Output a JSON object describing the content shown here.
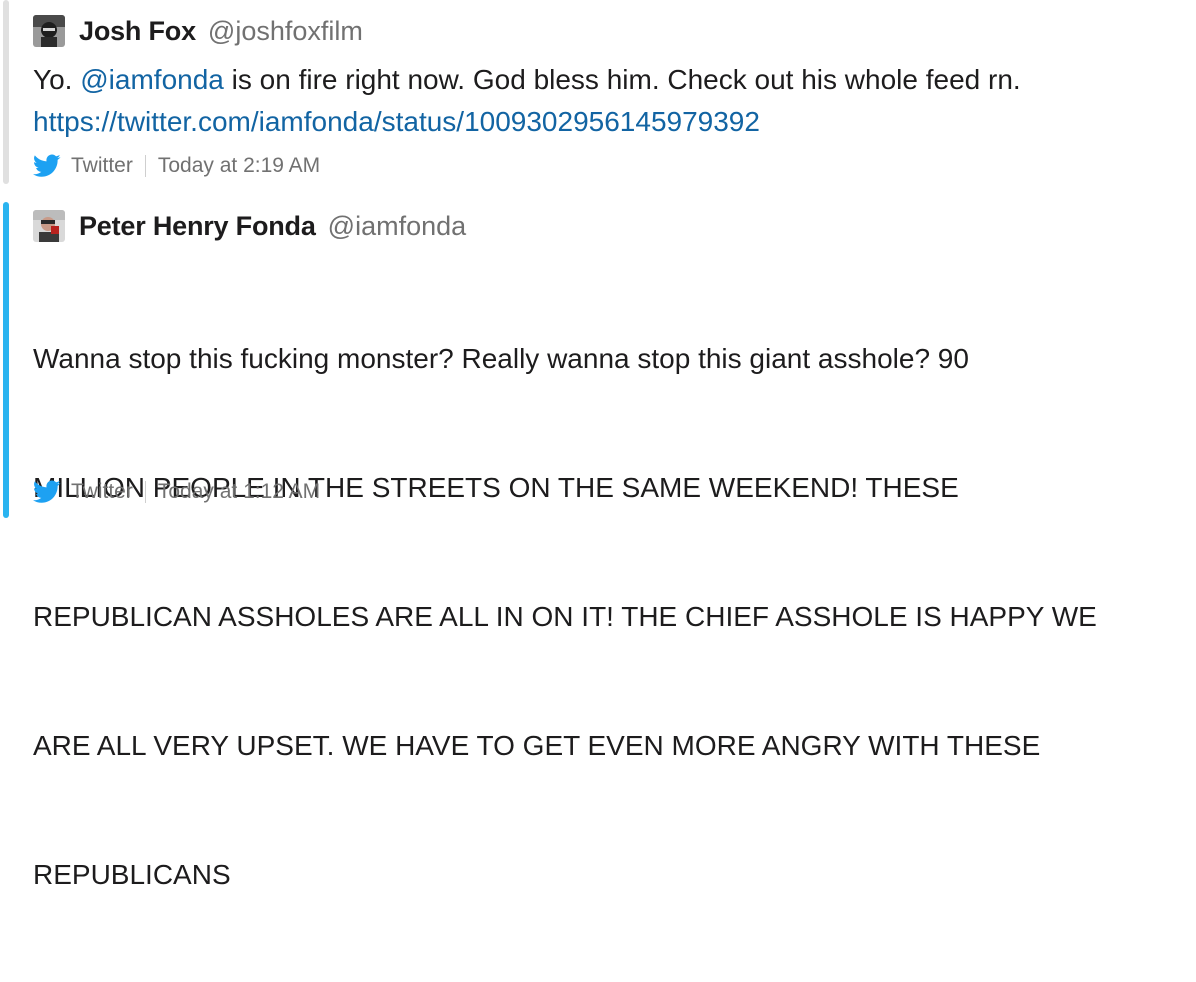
{
  "colors": {
    "twitter_blue": "#1da1f2",
    "link": "#1264a3",
    "accent_bar_active": "#2ab4f0",
    "accent_bar_inactive": "#e0e0e0"
  },
  "attachments": [
    {
      "author_name": "Josh Fox",
      "author_handle": "@joshfoxfilm",
      "avatar_icon": "user-avatar",
      "text_prefix": "Yo. ",
      "mention": "@iamfonda",
      "text_suffix": " is on fire right now. God bless him. Check out his whole feed rn.",
      "url": "https://twitter.com/iamfonda/status/1009302956145979392",
      "source": "Twitter",
      "timestamp": "Today at 2:19 AM"
    },
    {
      "author_name": "Peter Henry Fonda",
      "author_handle": "@iamfonda",
      "avatar_icon": "user-avatar",
      "text_lines": [
        "Wanna stop this fucking monster? Really wanna stop this giant asshole? 90",
        "MILLION PEOPLE IN THE STREETS ON THE SAME WEEKEND! THESE",
        "REPUBLICAN ASSHOLES ARE ALL IN ON IT! THE CHIEF ASSHOLE IS HAPPY WE",
        "ARE ALL VERY UPSET. WE HAVE TO GET EVEN MORE ANGRY WITH THESE",
        "REPUBLICANS"
      ],
      "source": "Twitter",
      "timestamp": "Today at 1:12 AM"
    }
  ]
}
